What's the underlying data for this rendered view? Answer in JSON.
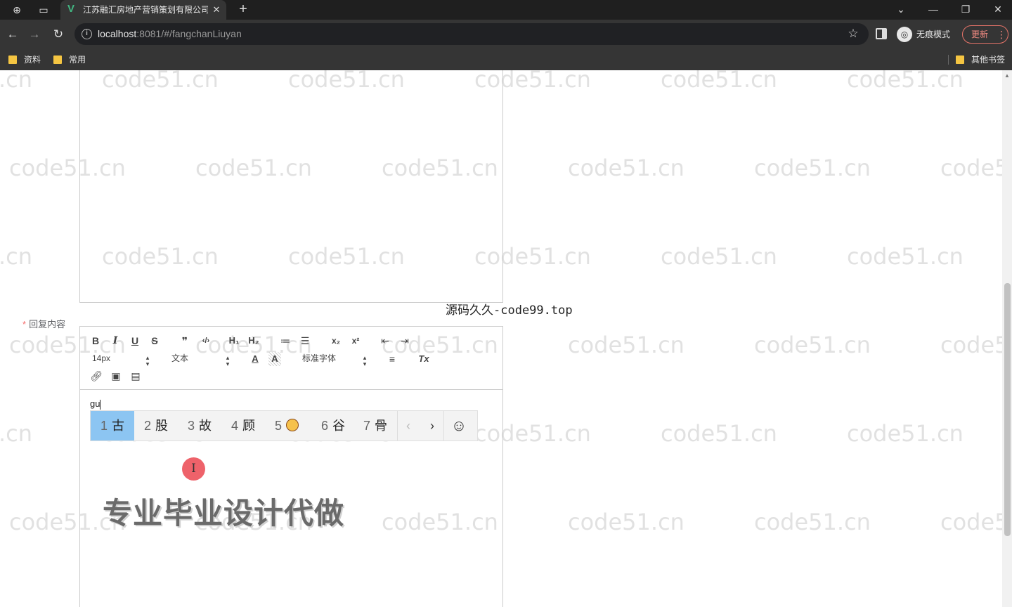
{
  "browser": {
    "tab_title": "江苏融汇房地产营销策划有限公司",
    "tab_close": "✕",
    "new_tab": "+",
    "url_host": "localhost",
    "url_rest": ":8081/#/fangchanLiuyan",
    "incognito_label": "无痕模式",
    "update_label": "更新",
    "bookmarks": [
      "资料",
      "常用"
    ],
    "other_bookmarks": "其他书签",
    "icons": [
      "chrome-icon",
      "tab-search-icon",
      "back-icon",
      "forward-icon",
      "reload-icon",
      "info-icon",
      "star-icon",
      "side-panel-icon",
      "incognito-icon",
      "menu-icon",
      "minimize-icon",
      "restore-icon",
      "close-icon",
      "chevron-down-icon"
    ]
  },
  "form": {
    "reply_label": "回复内容",
    "required_mark": "*"
  },
  "toolbar": {
    "bold": "B",
    "italic": "I",
    "underline": "U",
    "strike": "S",
    "quote": "❞",
    "code": "‹/›",
    "h1": "H₁",
    "h2": "H₂",
    "ordered_list": "≔",
    "bullet_list": "☰",
    "subscript": "x₂",
    "superscript": "x²",
    "outdent": "⇤",
    "indent": "⇥",
    "font_size": "14px",
    "header_type": "文本",
    "font_family": "标准字体",
    "clean": "Tx"
  },
  "editor": {
    "typed_text": "gu"
  },
  "ime": {
    "candidates": [
      {
        "num": "1",
        "char": "古"
      },
      {
        "num": "2",
        "char": "股"
      },
      {
        "num": "3",
        "char": "故"
      },
      {
        "num": "4",
        "char": "顾"
      },
      {
        "num": "5",
        "char": ""
      },
      {
        "num": "6",
        "char": "谷"
      },
      {
        "num": "7",
        "char": "骨"
      }
    ],
    "prev": "‹",
    "next": "›",
    "emoji": "☺"
  },
  "overlay": {
    "source_note": "源码久久-code99.top",
    "promo_text": "专业毕业设计代做",
    "watermark": "code51.cn"
  }
}
